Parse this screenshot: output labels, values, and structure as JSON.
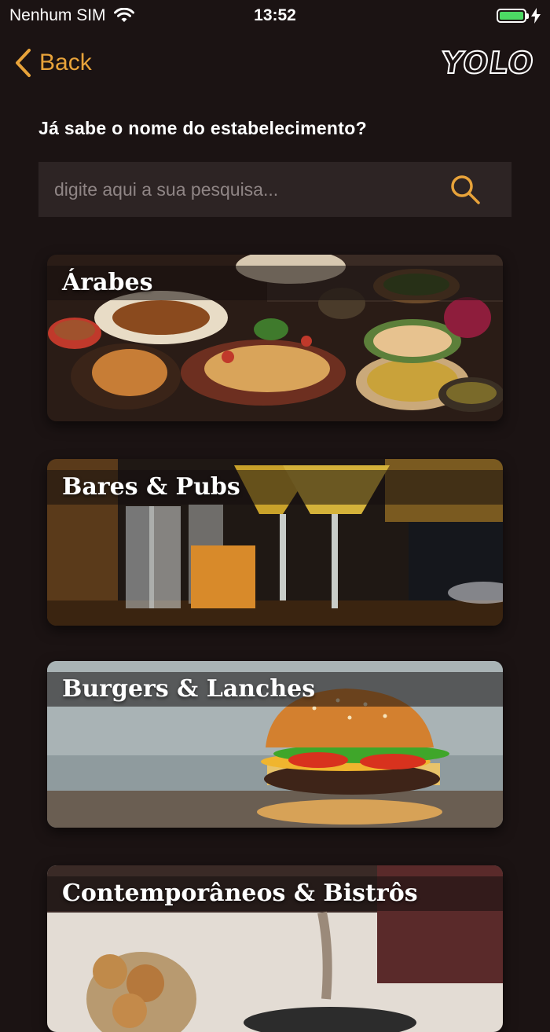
{
  "status_bar": {
    "carrier": "Nenhum SIM",
    "time": "13:52"
  },
  "nav": {
    "back_label": "Back",
    "logo_text": "YOLO"
  },
  "search": {
    "question": "Já sabe o nome do estabelecimento?",
    "placeholder": "digite aqui a sua pesquisa..."
  },
  "categories": [
    {
      "title": "Árabes"
    },
    {
      "title": "Bares & Pubs"
    },
    {
      "title": "Burgers & Lanches"
    },
    {
      "title": "Contemporâneos & Bistrôs"
    }
  ],
  "colors": {
    "background": "#1b1313",
    "accent": "#e8a33a",
    "search_bg": "#2d2424",
    "battery": "#4cd964"
  }
}
